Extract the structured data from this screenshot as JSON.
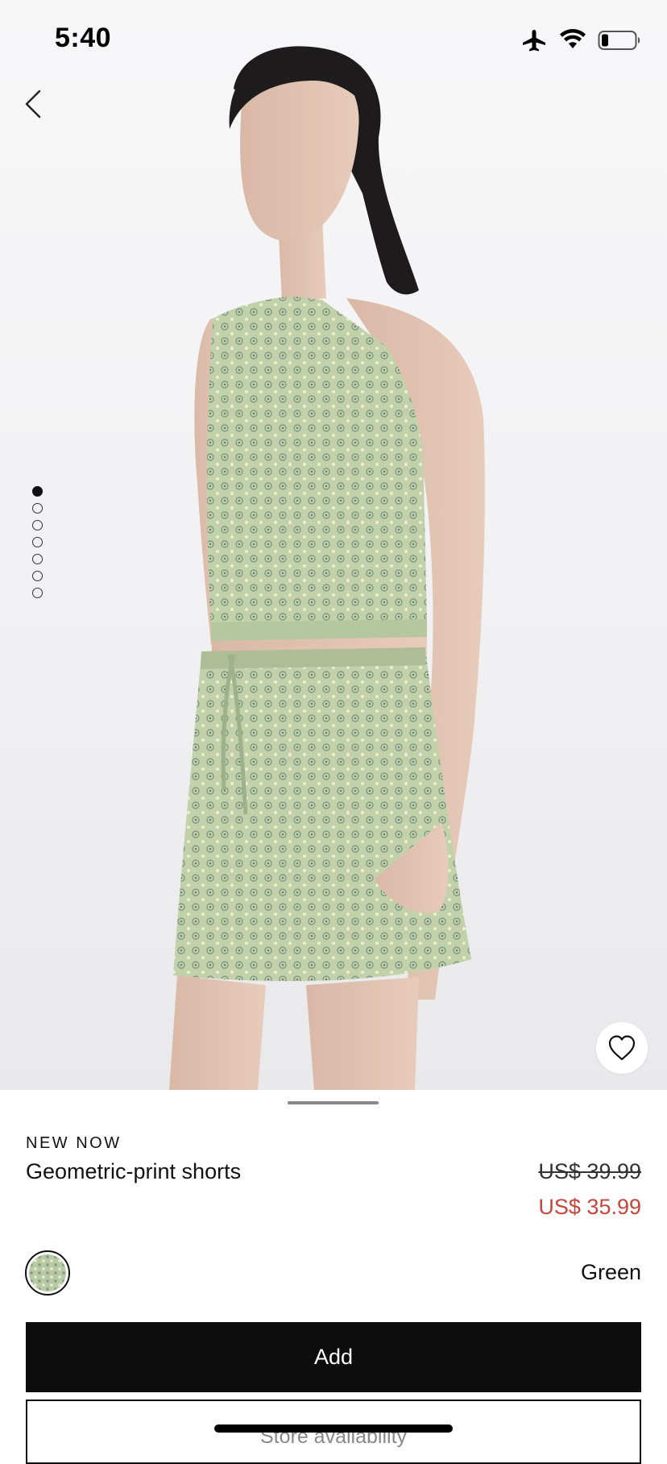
{
  "status_bar": {
    "time": "5:40",
    "icons": [
      "airplane-icon",
      "wifi-icon",
      "battery-icon"
    ]
  },
  "gallery": {
    "image_count": 7,
    "active_index": 0,
    "back_icon": "chevron-left-icon",
    "favorite_icon": "heart-outline-icon"
  },
  "product": {
    "tag": "NEW NOW",
    "title": "Geometric-print shorts",
    "original_price": "US$ 39.99",
    "sale_price": "US$ 35.99",
    "color_name": "Green"
  },
  "actions": {
    "add_label": "Add",
    "store_label": "Store availability"
  },
  "colors": {
    "sale": "#c4463c",
    "button_bg": "#0d0d0d",
    "print_base": "#b9c9a4"
  }
}
